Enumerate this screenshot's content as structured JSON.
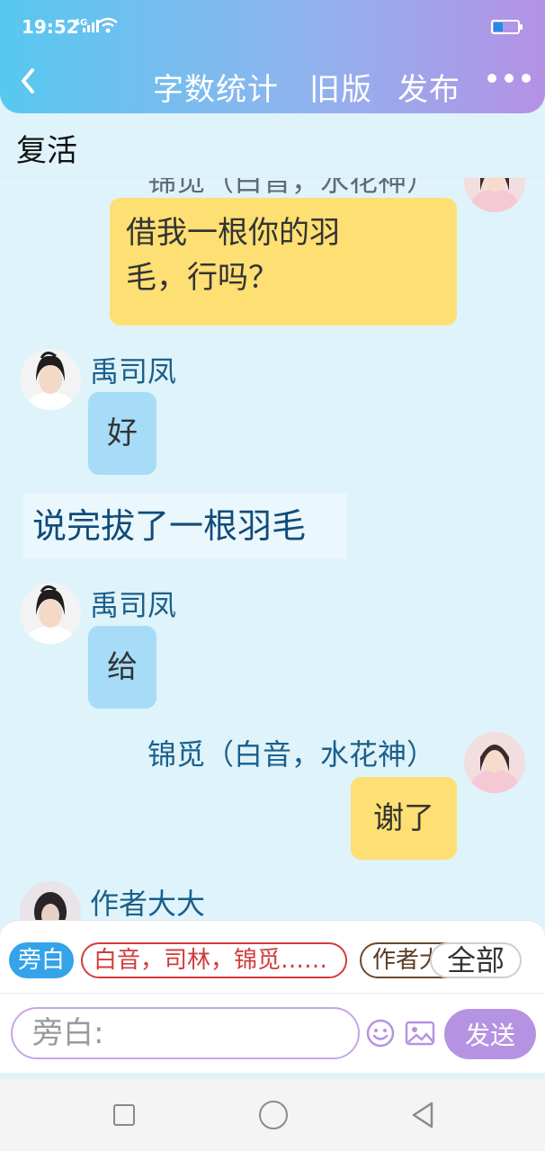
{
  "status_bar": {
    "time": "19:52",
    "network": "4G"
  },
  "header": {
    "word_count_label": "字数统计",
    "old_version_label": "旧版",
    "publish_label": "发布"
  },
  "chapter": {
    "title": "复活"
  },
  "chat": {
    "partial_top_name": "锦觅（白音，水花神）",
    "messages": [
      {
        "speaker": "锦觅（白音，水花神）",
        "text_line1": "借我一根你的羽",
        "text_line2": "毛，行吗？"
      },
      {
        "speaker": "禹司凤",
        "text": "好"
      },
      {
        "narration": "说完拔了一根羽毛"
      },
      {
        "speaker": "禹司凤",
        "text": "给"
      },
      {
        "speaker": "锦觅（白音，水花神）",
        "text": "谢了"
      },
      {
        "speaker": "作者大大"
      }
    ]
  },
  "composer": {
    "chips": {
      "narrator": "旁白",
      "group": "白音，司林，锦觅……",
      "author": "作者大大",
      "all": "全部"
    },
    "input_placeholder": "旁白:",
    "send_label": "发送"
  },
  "colors": {
    "header_gradient_start": "#56c8ef",
    "header_gradient_end": "#b491e6",
    "page_bg": "#dff3fb",
    "yellow_bubble": "#fddf73",
    "blue_bubble": "#a6dcf7",
    "send_button": "#b693e2"
  }
}
